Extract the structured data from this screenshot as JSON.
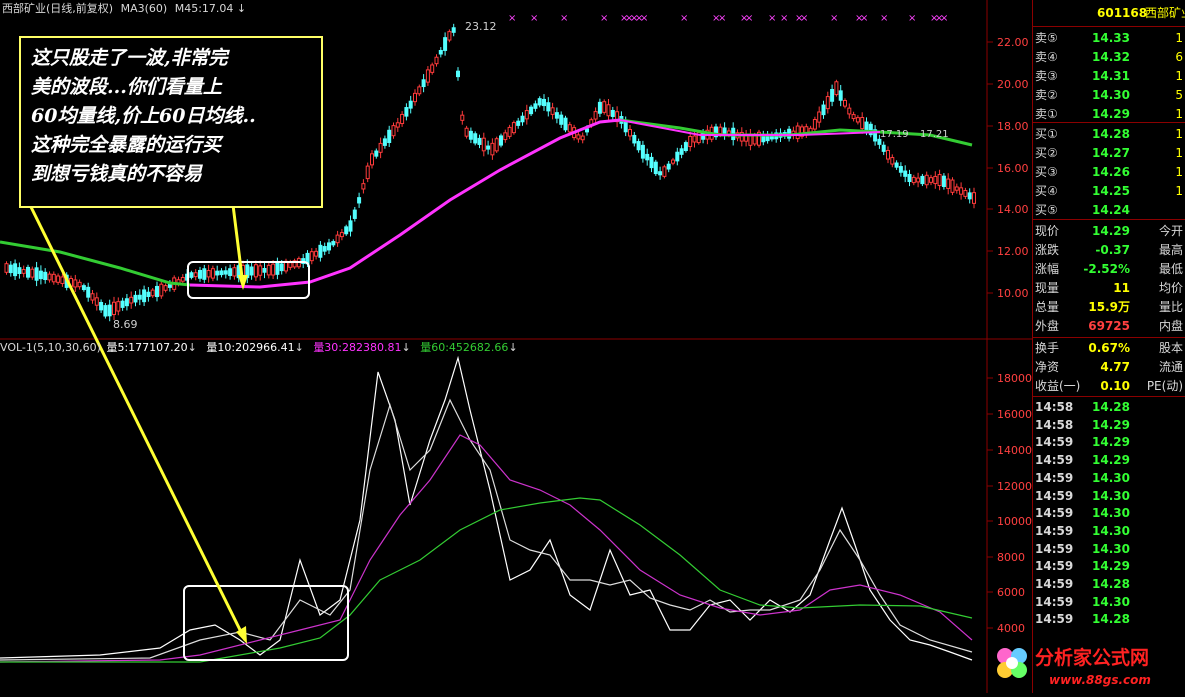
{
  "header": {
    "stock_title": "西部矿业(日线,前复权)",
    "ma3_label": "MA3(60)",
    "ma45_label": "M45:17.04",
    "arrow": "↓"
  },
  "price_axis": [
    "22.00",
    "20.00",
    "18.00",
    "16.00",
    "14.00",
    "12.00",
    "10.00"
  ],
  "price_annotations": {
    "high": "23.12",
    "low": "8.69",
    "mid": "17.19",
    "mid2": "17.21"
  },
  "volume_header": {
    "name": "VOL-1(5,10,30,60)",
    "v5": "量5:177107.20",
    "v10": "量10:202966.41",
    "v30": "量30:282380.81",
    "v60": "量60:452682.66"
  },
  "volume_axis": [
    "18000",
    "16000",
    "14000",
    "12000",
    "10000",
    "8000",
    "6000",
    "4000"
  ],
  "callout": {
    "line1": "这只股走了一波,非常完",
    "line2": "美的波段...你们看量上",
    "line3": "60均量线,价上60日均线..",
    "line4": "这种完全暴露的运行买",
    "line5": "到想亏钱真的不容易"
  },
  "quote": {
    "code": "601168",
    "name": "西部矿业",
    "sells": [
      {
        "label": "卖⑤",
        "price": "14.33",
        "vol": "1"
      },
      {
        "label": "卖④",
        "price": "14.32",
        "vol": "6"
      },
      {
        "label": "卖③",
        "price": "14.31",
        "vol": "1"
      },
      {
        "label": "卖②",
        "price": "14.30",
        "vol": "5"
      },
      {
        "label": "卖①",
        "price": "14.29",
        "vol": "1"
      }
    ],
    "buys": [
      {
        "label": "买①",
        "price": "14.28",
        "vol": "1"
      },
      {
        "label": "买②",
        "price": "14.27",
        "vol": "1"
      },
      {
        "label": "买③",
        "price": "14.26",
        "vol": "1"
      },
      {
        "label": "买④",
        "price": "14.25",
        "vol": "1"
      },
      {
        "label": "买⑤",
        "price": "14.24",
        "vol": ""
      }
    ],
    "stats": [
      {
        "label": "现价",
        "value": "14.29",
        "right": "今开"
      },
      {
        "label": "涨跌",
        "value": "-0.37",
        "right": "最高"
      },
      {
        "label": "涨幅",
        "value": "-2.52%",
        "right": "最低"
      },
      {
        "label": "现量",
        "value": "11",
        "right": "均价"
      },
      {
        "label": "总量",
        "value": "15.9万",
        "right": "量比"
      },
      {
        "label": "外盘",
        "value": "69725",
        "right": "内盘"
      }
    ],
    "extra": [
      {
        "label": "换手",
        "value": "0.67%",
        "right": "股本"
      },
      {
        "label": "净资",
        "value": "4.77",
        "right": "流通"
      },
      {
        "label": "收益(一)",
        "value": "0.10",
        "right": "PE(动)"
      }
    ],
    "ticks": [
      {
        "time": "14:58",
        "price": "14.28"
      },
      {
        "time": "14:58",
        "price": "14.29"
      },
      {
        "time": "14:59",
        "price": "14.29"
      },
      {
        "time": "14:59",
        "price": "14.29"
      },
      {
        "time": "14:59",
        "price": "14.30"
      },
      {
        "time": "14:59",
        "price": "14.30"
      },
      {
        "time": "14:59",
        "price": "14.30"
      },
      {
        "time": "14:59",
        "price": "14.30"
      },
      {
        "time": "14:59",
        "price": "14.30"
      },
      {
        "time": "14:59",
        "price": "14.29"
      },
      {
        "time": "14:59",
        "price": "14.28"
      },
      {
        "time": "14:59",
        "price": "14.30"
      },
      {
        "time": "14:59",
        "price": "14.28"
      }
    ]
  },
  "watermark": {
    "title": "分析家公式网",
    "url": "www.88gs.com"
  },
  "colors": {
    "up": "#ff3b3b",
    "down": "#54ffff",
    "ma60": "#ff33ff",
    "ma_green": "#33cc33",
    "panel_border": "#8b0000"
  }
}
